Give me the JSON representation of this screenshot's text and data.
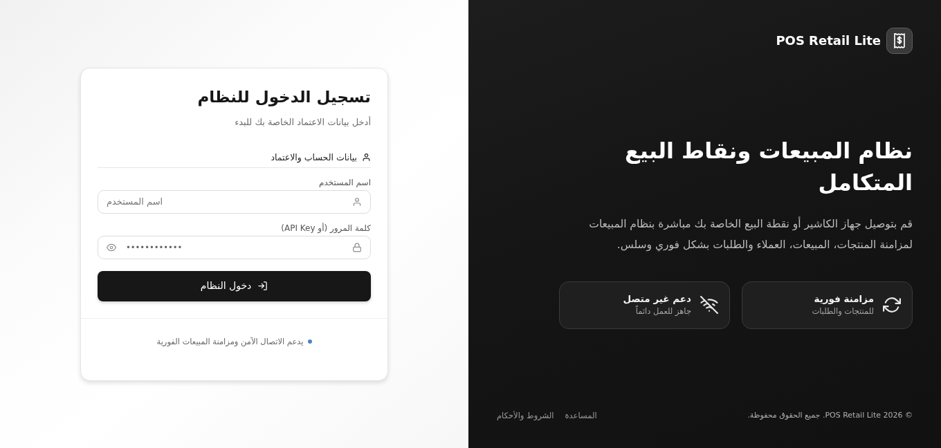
{
  "brand": {
    "name": "POS Retail Lite"
  },
  "hero": {
    "title": "نظام المبيعات ونقاط البيع المتكامل",
    "description": "قم بتوصيل جهاز الكاشير أو نقطة البيع الخاصة بك مباشرة بنظام المبيعات لمزامنة المنتجات، المبيعات، العملاء والطلبات بشكل فوري وسلس."
  },
  "features": [
    {
      "kind": "sync",
      "title": "مزامنة فورية",
      "subtitle": "للمنتجات والطلبات"
    },
    {
      "kind": "offline",
      "title": "دعم غير متصل",
      "subtitle": "جاهز للعمل دائماً"
    }
  ],
  "footer": {
    "copyright": "© 2026 POS Retail Lite. جميع الحقوق محفوظة.",
    "links": [
      "المساعدة",
      "الشروط والأحكام"
    ]
  },
  "login": {
    "title": "تسجيل الدخول للنظام",
    "subtitle": "أدخل بيانات الاعتماد الخاصة بك للبدء",
    "section": "بيانات الحساب والاعتماد",
    "fields": [
      {
        "kind": "text",
        "label": "اسم المستخدم",
        "placeholder": "اسم المستخدم"
      },
      {
        "kind": "password",
        "label": "كلمة المرور (أو API Key)",
        "value": "••••••••••••"
      }
    ],
    "submit": "دخول النظام",
    "note": "يدعم الاتصال الآمن ومزامنة المبيعات الفورية"
  }
}
